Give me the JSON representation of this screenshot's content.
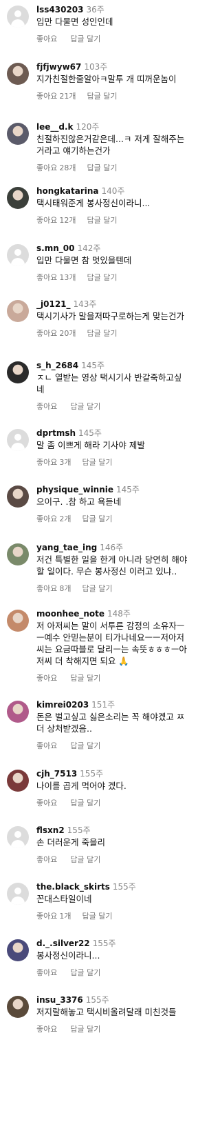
{
  "comments": [
    {
      "username": "lss430203",
      "time": "36주",
      "text": "입만 다물면 성인인데",
      "likes_label": "좋아요",
      "likes_count": "",
      "reply_label": "답글 달기",
      "avatar": "default",
      "avatar_color": "#dcdcdc"
    },
    {
      "username": "fjfjwyw67",
      "time": "103주",
      "text": "지가친절한줄알아ㅋ말투 개 띠꺼운놈이",
      "likes_label": "좋아요",
      "likes_count": "21개",
      "reply_label": "답글 달기",
      "avatar": "photo",
      "avatar_color": "#6d5b52"
    },
    {
      "username": "lee__d.k",
      "time": "120주",
      "text": "친절하진않은거같은데...ㅋ 저게 잘해주는\n거라고 얘기하는건가",
      "likes_label": "좋아요",
      "likes_count": "28개",
      "reply_label": "답글 달기",
      "avatar": "photo",
      "avatar_color": "#5b5b6a"
    },
    {
      "username": "hongkatarina",
      "time": "140주",
      "text": "택시태워준게 봉사정신이라니...",
      "likes_label": "좋아요",
      "likes_count": "12개",
      "reply_label": "답글 달기",
      "avatar": "photo",
      "avatar_color": "#3b3f3a"
    },
    {
      "username": "s.mn_00",
      "time": "142주",
      "text": "입만 다물면 참 멋있을텐데",
      "likes_label": "좋아요",
      "likes_count": "13개",
      "reply_label": "답글 달기",
      "avatar": "default",
      "avatar_color": "#dcdcdc"
    },
    {
      "username": "_j0121_",
      "time": "143주",
      "text": "택시기사가 말을저따구로하는게 맞는건가",
      "likes_label": "좋아요",
      "likes_count": "20개",
      "reply_label": "답글 달기",
      "avatar": "photo",
      "avatar_color": "#c9a99a"
    },
    {
      "username": "s_h_2684",
      "time": "145주",
      "text": "ㅈㄴ 열받는 영상 택시기사 반갈죽하고싶\n네",
      "likes_label": "좋아요",
      "likes_count": "",
      "reply_label": "답글 달기",
      "avatar": "photo",
      "avatar_color": "#2a2a2a"
    },
    {
      "username": "dprtmsh",
      "time": "145주",
      "text": "말 좀 이쁘게 해라 기사야 제발",
      "likes_label": "좋아요",
      "likes_count": "3개",
      "reply_label": "답글 달기",
      "avatar": "default",
      "avatar_color": "#dcdcdc"
    },
    {
      "username": "physique_winnie",
      "time": "145주",
      "text": "으이구. .참 하고 욕듣네",
      "likes_label": "좋아요",
      "likes_count": "2개",
      "reply_label": "답글 달기",
      "avatar": "photo",
      "avatar_color": "#5a4a44"
    },
    {
      "username": "yang_tae_ing",
      "time": "146주",
      "text": "저건 특별한 일을 한게 아니라 당연히 해야\n할 일이다. 무슨 봉사정신 이러고 있냐..",
      "likes_label": "좋아요",
      "likes_count": "8개",
      "reply_label": "답글 달기",
      "avatar": "photo",
      "avatar_color": "#7a8a6a"
    },
    {
      "username": "moonhee_note",
      "time": "148주",
      "text": "저 아저씨는 말이 서투른 감정의 소유자ㅡ\nㅡ예수 안믿는분이 티가나네요ㅡㅡ저아저\n씨는 요금따블로 달리ㅡ는 속뜻ㅎㅎㅎㅡ아\n저씨 더 착해지면 되요 🙏",
      "likes_label": "좋아요",
      "likes_count": "",
      "reply_label": "답글 달기",
      "avatar": "photo",
      "avatar_color": "#c48a6a"
    },
    {
      "username": "kimrei0203",
      "time": "151주",
      "text": "돈은 벌고싶고 싫은소리는 꼭 해야겠고 ㅉ\n더 상처받겠음..",
      "likes_label": "좋아요",
      "likes_count": "",
      "reply_label": "답글 달기",
      "avatar": "photo",
      "avatar_color": "#b05a8a"
    },
    {
      "username": "cjh_7513",
      "time": "155주",
      "text": "나이를 곱게 먹어야 겠다.",
      "likes_label": "좋아요",
      "likes_count": "",
      "reply_label": "답글 달기",
      "avatar": "photo",
      "avatar_color": "#7a3a3a"
    },
    {
      "username": "flsxn2",
      "time": "155주",
      "text": "손 더러운게 죽을리",
      "likes_label": "좋아요",
      "likes_count": "",
      "reply_label": "답글 달기",
      "avatar": "default",
      "avatar_color": "#dcdcdc"
    },
    {
      "username": "the.black_skirts",
      "time": "155주",
      "text": "꼰대스타일이네",
      "likes_label": "좋아요",
      "likes_count": "1개",
      "reply_label": "답글 달기",
      "avatar": "default",
      "avatar_color": "#dcdcdc"
    },
    {
      "username": "d._.silver22",
      "time": "155주",
      "text": "봉사정신이라니...",
      "likes_label": "좋아요",
      "likes_count": "",
      "reply_label": "답글 달기",
      "avatar": "photo",
      "avatar_color": "#4a4a7a"
    },
    {
      "username": "insu_3376",
      "time": "155주",
      "text": "저지랄해놓고 택시비올려달래 미친것들",
      "likes_label": "좋아요",
      "likes_count": "",
      "reply_label": "답글 달기",
      "avatar": "photo",
      "avatar_color": "#5a4a3a"
    }
  ]
}
